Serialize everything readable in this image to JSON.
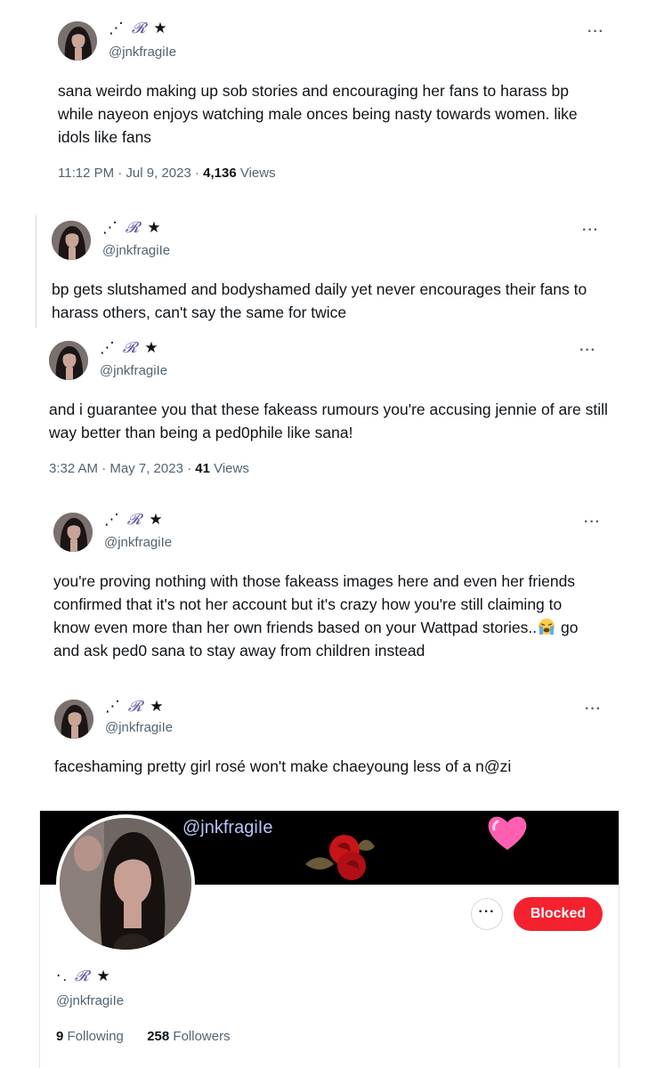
{
  "display_name": {
    "prefix": "⋰",
    "swirl": "𝓡",
    "suffix": "★"
  },
  "handle": "@jnkfragiIe",
  "more_label": "···",
  "tweets": [
    {
      "text": "sana weirdo making up sob stories and encouraging her fans to harass bp while nayeon enjoys watching male onces being nasty towards women. like idols like fans",
      "time": "11:12 PM · Jul 9, 2023 · ",
      "views_count": "4,136",
      "views_label": " Views"
    },
    {
      "text": "bp gets slutshamed and bodyshamed daily yet never encourages their fans to harass others, can't say the same for twice"
    },
    {
      "text": "and i guarantee you that these fakeass rumours you're accusing jennie of are still way better than being a ped0phile like sana!",
      "time": "3:32 AM · May 7, 2023 · ",
      "views_count": "41",
      "views_label": " Views"
    },
    {
      "text_before": "you're proving nothing with those fakeass images here and even her friends confirmed that it's not her account but it's crazy how you're still claiming to know even more than her own friends based on your Wattpad stories..",
      "emoji": "loudly-crying-face",
      "text_after": " go and ask ped0 sana to stay away from children instead"
    },
    {
      "text": "faceshaming pretty girl rosé won't make chaeyoung less of a n@zi"
    }
  ],
  "profile": {
    "banner_text": "@jnkfragiIe",
    "name": {
      "prefix": "⋅.",
      "swirl": "𝓡",
      "suffix": "★"
    },
    "handle": "@jnkfragiIe",
    "more_label": "···",
    "blocked_label": "Blocked",
    "following_count": "9",
    "following_label": " Following",
    "followers_count": "258",
    "followers_label": " Followers"
  },
  "colors": {
    "blocked": "#f4212e",
    "secondary_text": "#536471",
    "swirl": "#6d5fa6"
  }
}
